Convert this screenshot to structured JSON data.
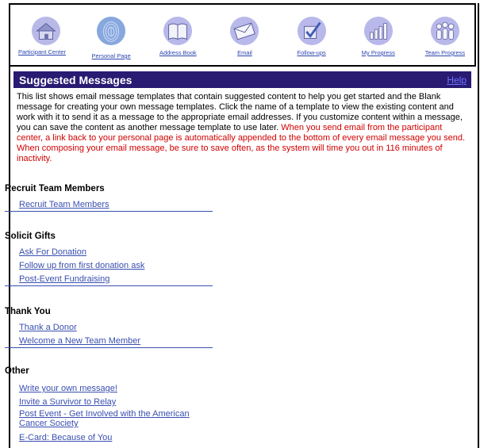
{
  "nav": {
    "items": [
      {
        "label": "Participant Center",
        "icon": "house-icon"
      },
      {
        "label": "Personal Page",
        "icon": "fingerprint-icon"
      },
      {
        "label": "Address Book",
        "icon": "open-book-icon"
      },
      {
        "label": "Email",
        "icon": "envelope-icon"
      },
      {
        "label": "Follow-ups",
        "icon": "checkmark-icon"
      },
      {
        "label": "My Progress",
        "icon": "bar-chart-icon"
      },
      {
        "label": "Team Progress",
        "icon": "team-icon"
      }
    ]
  },
  "header": {
    "title": "Suggested Messages",
    "help": "Help"
  },
  "intro": {
    "text": "This list shows email message templates that contain suggested content to help you get started and the Blank message for creating your own message templates. Click the name of a template to view the existing content and work with it to send it as a message to the appropriate email addresses. If you customize content within a message, you can save the content as another message template to use later. ",
    "warning": "When you send email from the participant center, a link back to your personal page is automatically appended to the bottom of every email message you send. When composing your email message, be sure to save often, as the system will time you out in 116 minutes of inactivity."
  },
  "groups": [
    {
      "title": "Recruit Team Members",
      "links": [
        "Recruit Team Members"
      ]
    },
    {
      "title": "Solicit Gifts",
      "links": [
        "Ask For Donation",
        "Follow up from first donation ask",
        "Post-Event Fundraising"
      ]
    },
    {
      "title": "Thank You",
      "links": [
        "Thank a Donor",
        "Welcome a New Team Member"
      ]
    },
    {
      "title": "Other",
      "links": [
        "Write your own message!",
        "Invite a Survivor to Relay",
        "Post Event - Get Involved with the American Cancer Society",
        "E-Card: Because of You"
      ]
    }
  ],
  "colors": {
    "header": "#291a72",
    "link": "#3a4fb0",
    "warning": "#d10000",
    "help": "#6f77ff"
  }
}
